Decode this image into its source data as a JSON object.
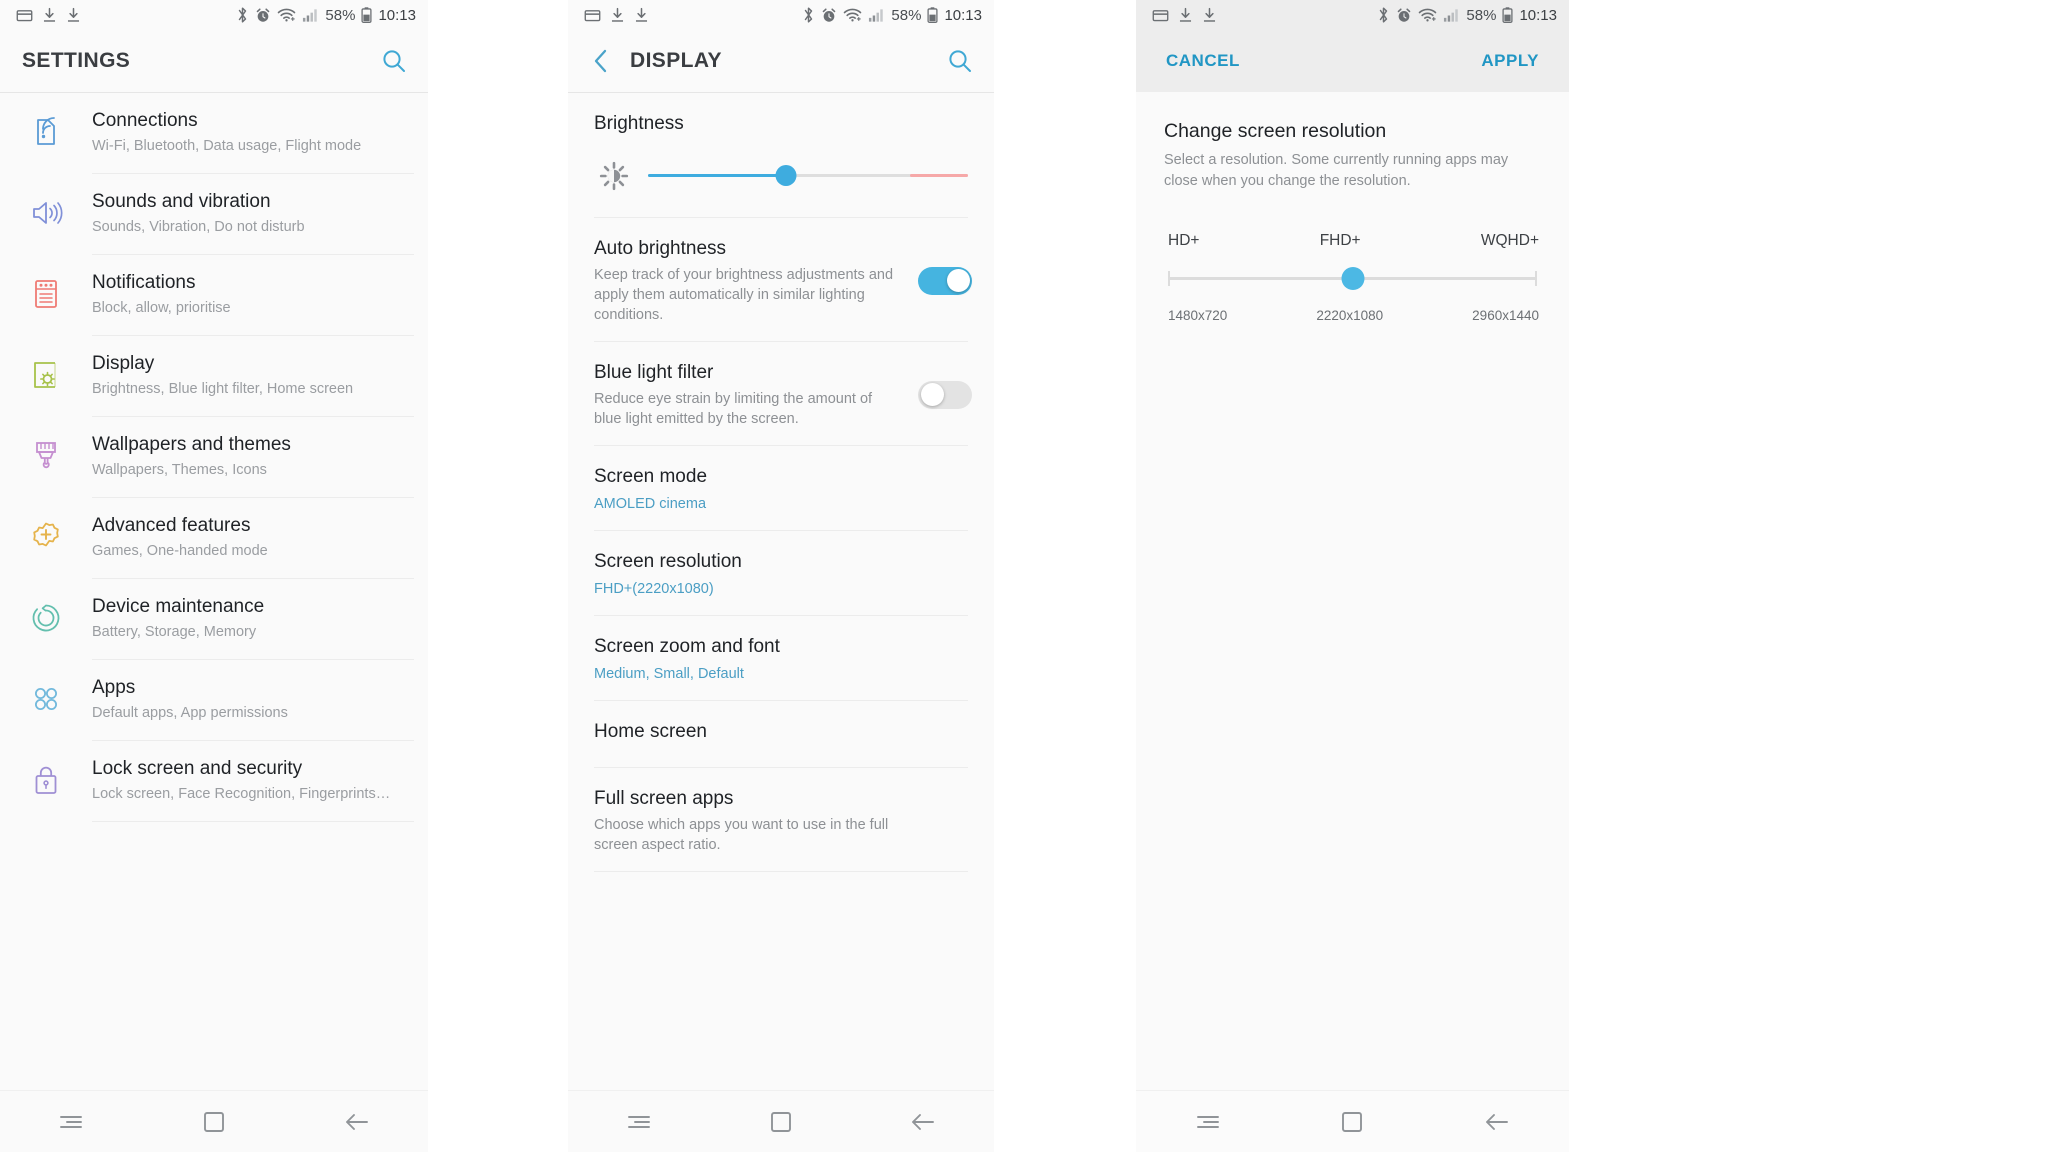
{
  "statusbar": {
    "icons_left": [
      "card-icon",
      "download-icon",
      "download-icon"
    ],
    "icons_right": [
      "bluetooth-icon",
      "alarm-icon",
      "wifi-icon",
      "signal-icon"
    ],
    "battery": "58%",
    "time": "10:13"
  },
  "colors": {
    "accent": "#3eacdf",
    "accent_dark": "#2196c4",
    "link": "#4b9ec4",
    "title": "#3a3d41",
    "body": "#1f2226",
    "subtle": "#9a9da1",
    "panel_bg": "#fafafa",
    "action_bg": "#ededed",
    "slider_warn": "#f6a8a8",
    "toggle_on": "#45b4e0",
    "toggle_off": "#e3e3e3"
  },
  "panel_settings": {
    "title": "SETTINGS",
    "search_icon": "search-icon",
    "items": [
      {
        "icon": "connections-icon",
        "icon_color": "#5b9bd5",
        "label": "Connections",
        "sub": "Wi-Fi, Bluetooth, Data usage, Flight mode"
      },
      {
        "icon": "sound-icon",
        "icon_color": "#8090d8",
        "label": "Sounds and vibration",
        "sub": "Sounds, Vibration, Do not disturb"
      },
      {
        "icon": "notifications-icon",
        "icon_color": "#ef7b74",
        "label": "Notifications",
        "sub": "Block, allow, prioritise"
      },
      {
        "icon": "display-icon",
        "icon_color": "#a7c24a",
        "label": "Display",
        "sub": "Brightness, Blue light filter, Home screen"
      },
      {
        "icon": "paintbrush-icon",
        "icon_color": "#c58fd0",
        "label": "Wallpapers and themes",
        "sub": "Wallpapers, Themes, Icons"
      },
      {
        "icon": "advanced-features-icon",
        "icon_color": "#e5b košice"
      }
    ]
  }
}
